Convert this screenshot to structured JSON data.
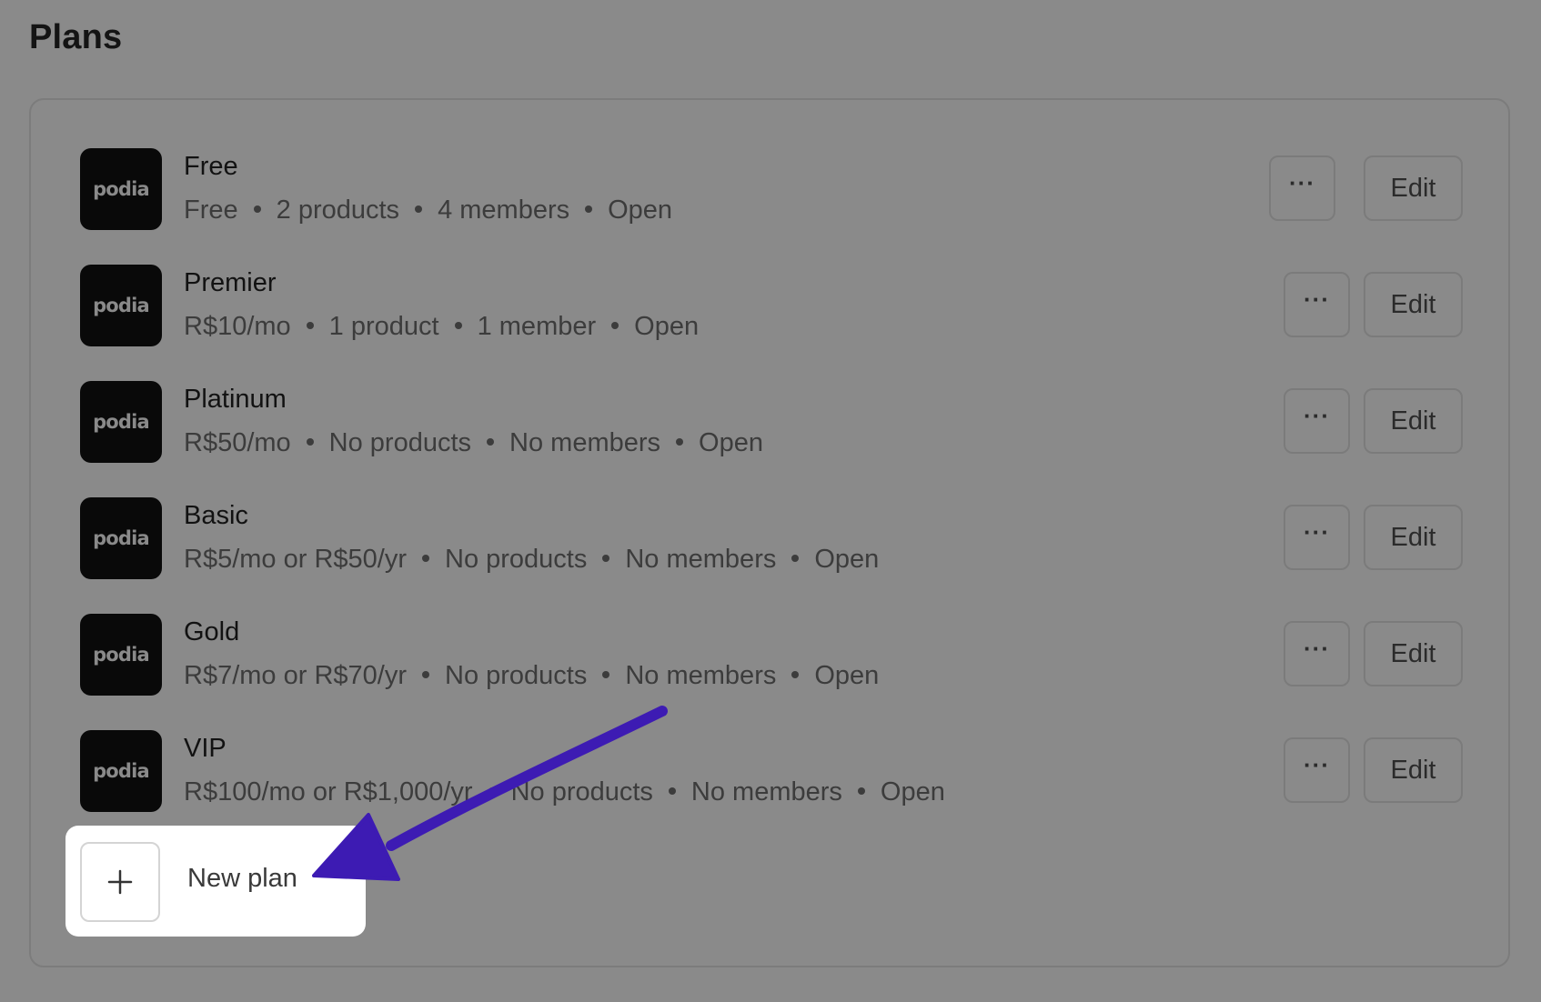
{
  "page": {
    "title": "Plans"
  },
  "brand_logo_text": "podia",
  "plans": [
    {
      "name": "Free",
      "price": "Free",
      "products": "2 products",
      "members": "4 members",
      "status": "Open",
      "more_label": "···",
      "edit_label": "Edit"
    },
    {
      "name": "Premier",
      "price": "R$10/mo",
      "products": "1 product",
      "members": "1 member",
      "status": "Open",
      "more_label": "···",
      "edit_label": "Edit"
    },
    {
      "name": "Platinum",
      "price": "R$50/mo",
      "products": "No products",
      "members": "No members",
      "status": "Open",
      "more_label": "···",
      "edit_label": "Edit"
    },
    {
      "name": "Basic",
      "price": "R$5/mo or R$50/yr",
      "products": "No products",
      "members": "No members",
      "status": "Open",
      "more_label": "···",
      "edit_label": "Edit"
    },
    {
      "name": "Gold",
      "price": "R$7/mo or R$70/yr",
      "products": "No products",
      "members": "No members",
      "status": "Open",
      "more_label": "···",
      "edit_label": "Edit"
    },
    {
      "name": "VIP",
      "price": "R$100/mo or R$1,000/yr",
      "products": "No products",
      "members": "No members",
      "status": "Open",
      "more_label": "···",
      "edit_label": "Edit"
    }
  ],
  "new_plan": {
    "icon": "plus-icon",
    "label": "New plan"
  },
  "colors": {
    "background": "#8a8a8a",
    "logo_bg": "#090909",
    "card_bg": "#ffffff",
    "arrow": "#3d1bb3"
  }
}
